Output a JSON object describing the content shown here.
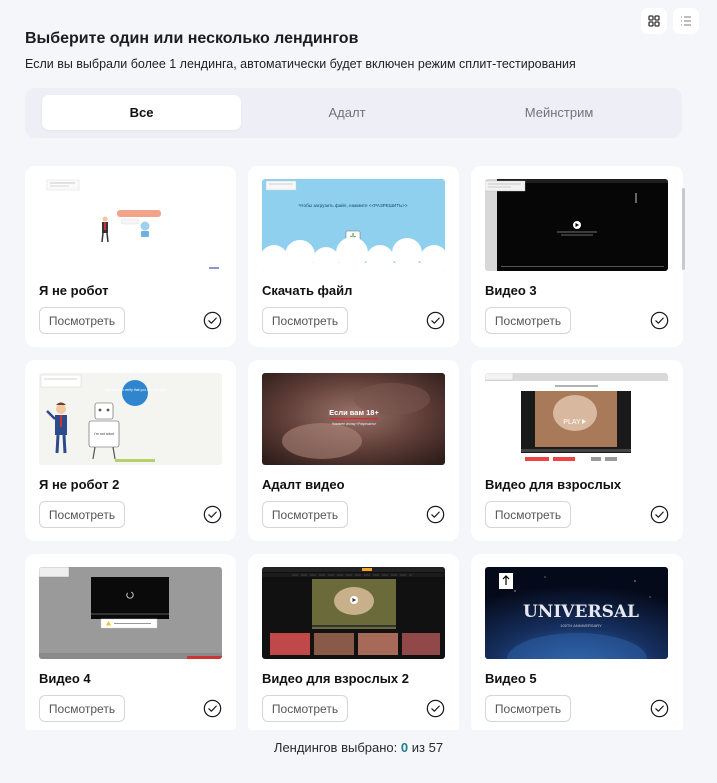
{
  "header": {
    "title": "Выберите один или несколько лендингов",
    "subtitle": "Если вы выбрали более 1 лендинга, автоматически будет включен режим сплит-тестирования"
  },
  "tabs": [
    {
      "label": "Все",
      "active": true
    },
    {
      "label": "Адалт",
      "active": false
    },
    {
      "label": "Мейнстрим",
      "active": false
    }
  ],
  "cards": [
    {
      "name": "Я не робот",
      "button": "Посмотреть"
    },
    {
      "name": "Скачать файл",
      "button": "Посмотреть"
    },
    {
      "name": "Видео 3",
      "button": "Посмотреть"
    },
    {
      "name": "Я не робот 2",
      "button": "Посмотреть"
    },
    {
      "name": "Адалт видео",
      "button": "Посмотреть"
    },
    {
      "name": "Видео для взрослых",
      "button": "Посмотреть"
    },
    {
      "name": "Видео 4",
      "button": "Посмотреть"
    },
    {
      "name": "Видео для взрослых 2",
      "button": "Посмотреть"
    },
    {
      "name": "Видео 5",
      "button": "Посмотреть"
    }
  ],
  "thumbnails": {
    "download": "Чтобы загрузить файл, нажмите <<РАЗРЕШИТЬ>>",
    "robot2_bubble": "Type allow to verify that you are not robot",
    "robot2_sign": "I'm not robot",
    "adult_banner": "Если вам 18+",
    "adult_sub": "Нажмите кнопку «Разрешить»",
    "adult_video_play": "PLAY",
    "universal": "UNIVERSAL",
    "universal_sub": "100TH ANNIVERSARY"
  },
  "footer": {
    "label": "Лендингов выбрано:",
    "selected": "0",
    "separator": "из",
    "total": "57"
  },
  "colors": {
    "accent": "#1d7f8c",
    "card_bg": "#ffffff",
    "page_bg": "#f5f6fa"
  }
}
